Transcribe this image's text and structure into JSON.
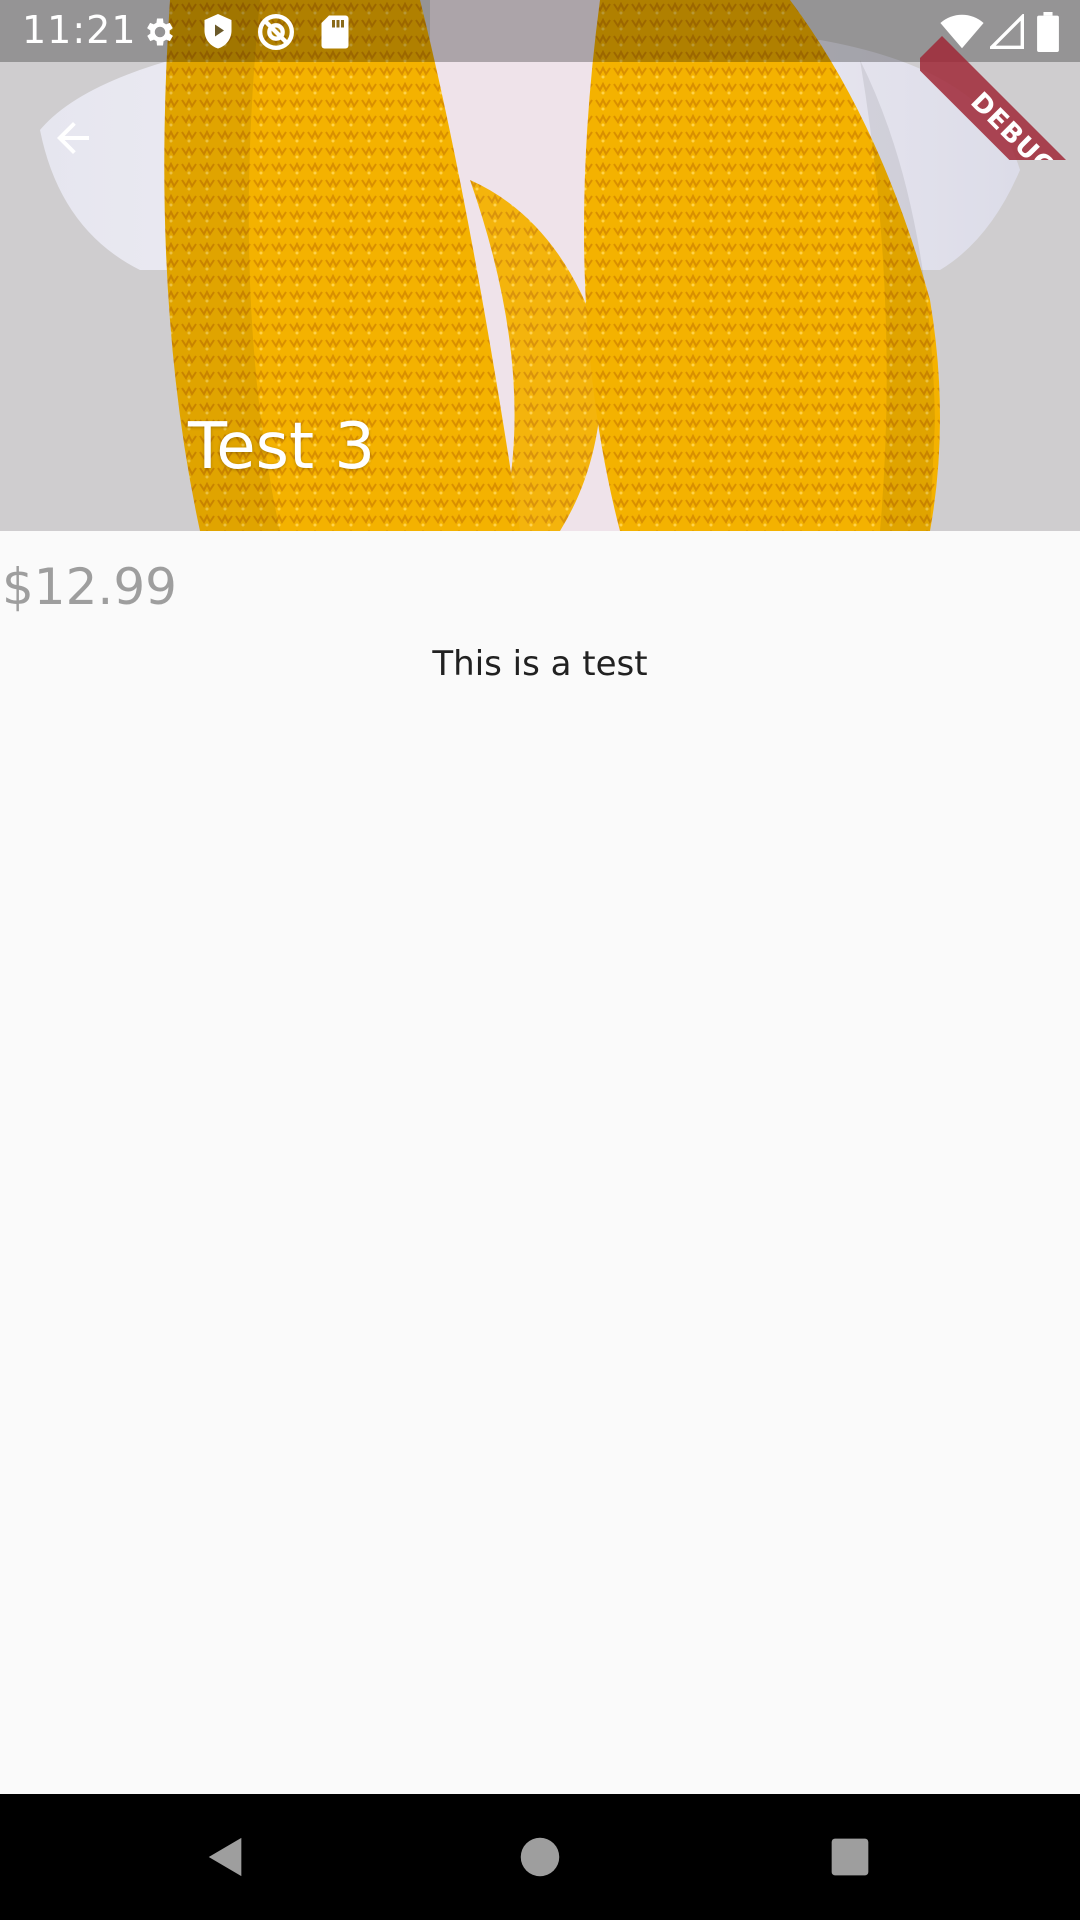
{
  "status_bar": {
    "time": "11:21",
    "left_icons": [
      "settings-icon",
      "shield-play-icon",
      "at-sign-icon",
      "sd-card-icon"
    ],
    "right_icons": [
      "wifi-icon",
      "signal-icon",
      "battery-icon"
    ]
  },
  "debug_banner": {
    "label": "DEBUG",
    "color": "#a02837"
  },
  "product": {
    "title": "Test 3",
    "price": "$12.99",
    "description": "This is a test"
  },
  "colors": {
    "background": "#fafafa",
    "price": "#9e9e9e",
    "description": "#212121",
    "scarf": "#f5b400"
  },
  "navigation_bar": {
    "buttons": [
      "back-triangle-icon",
      "home-circle-icon",
      "recents-square-icon"
    ]
  }
}
